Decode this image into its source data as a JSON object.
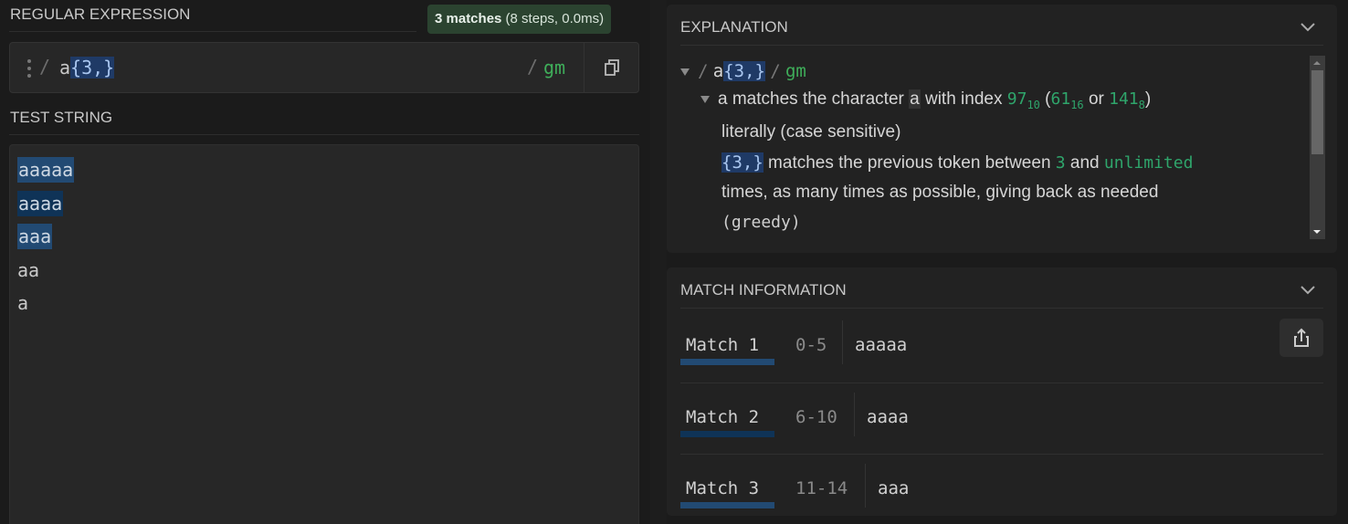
{
  "regex_section": {
    "title": "REGULAR EXPRESSION",
    "badge": {
      "count_label": "3 matches",
      "detail": "(8 steps, 0.0ms)"
    },
    "delimiter": "/",
    "pattern_literal": "a",
    "pattern_quantifier": "{3,}",
    "flags": "gm",
    "icons": {
      "drag": "drag-handle-icon",
      "copy": "copy-icon"
    }
  },
  "test_section": {
    "title": "TEST STRING",
    "lines": [
      {
        "text": "aaaaa",
        "highlight": "match-odd"
      },
      {
        "text": "aaaa",
        "highlight": "match-even"
      },
      {
        "text": "aaa",
        "highlight": "match-odd"
      },
      {
        "text": "aa",
        "highlight": null
      },
      {
        "text": "a",
        "highlight": null
      }
    ]
  },
  "explanation": {
    "title": "EXPLANATION",
    "root": {
      "delim": "/",
      "literal": "a",
      "quant": "{3,}",
      "flags": "gm"
    },
    "item1": {
      "token": "a",
      "text1": "matches the character",
      "char": "a",
      "text2": "with index",
      "dec": "97",
      "dec_base": "10",
      "hex": "61",
      "hex_base": "16",
      "or": "or",
      "oct": "141",
      "oct_base": "8",
      "cont": "literally (case sensitive)"
    },
    "item2": {
      "token": "{3,}",
      "text1": "matches the previous token between",
      "min": "3",
      "and": "and",
      "max": "unlimited",
      "text2": "times, as many times as possible, giving back as needed",
      "mode": "(greedy)"
    }
  },
  "match_info": {
    "title": "MATCH INFORMATION",
    "matches": [
      {
        "label": "Match 1",
        "range": "0-5",
        "value": "aaaaa"
      },
      {
        "label": "Match 2",
        "range": "6-10",
        "value": "aaaa"
      },
      {
        "label": "Match 3",
        "range": "11-14",
        "value": "aaa"
      }
    ],
    "share_icon": "share-icon"
  },
  "colors": {
    "match_odd": "#224a73",
    "match_even": "#0f3357",
    "flag_green": "#3fae5a",
    "badge_bg": "#2b4330"
  }
}
